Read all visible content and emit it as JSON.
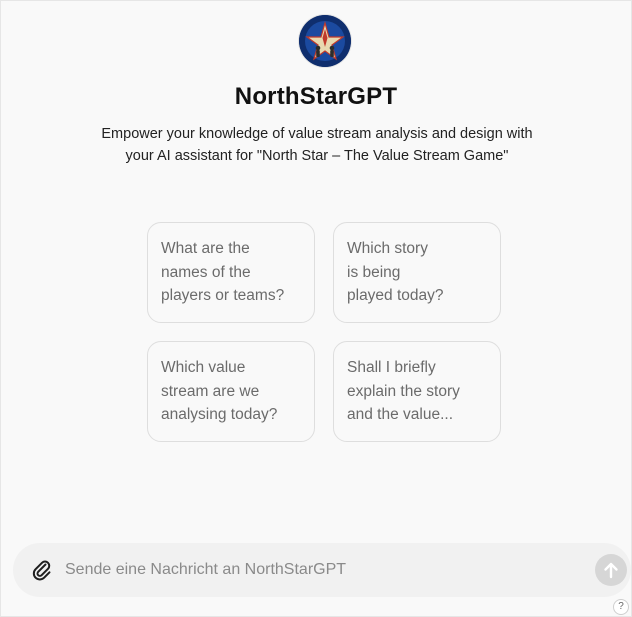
{
  "header": {
    "logo_icon": "north-star-compass-logo",
    "title": "NorthStarGPT",
    "description": "Empower your knowledge of value stream analysis and design with\nyour AI assistant for \"North Star – The Value Stream Game\""
  },
  "suggestions": [
    {
      "text": "What are the\nnames of the\nplayers or teams?"
    },
    {
      "text": "Which story\nis being\nplayed today?"
    },
    {
      "text": "Which value\nstream are we\nanalysing today?"
    },
    {
      "text": "Shall I briefly\nexplain the story\nand the value..."
    }
  ],
  "composer": {
    "attach_icon": "paperclip-icon",
    "placeholder": "Sende eine Nachricht an NorthStarGPT",
    "value": "",
    "send_icon": "arrow-up-icon"
  },
  "help": {
    "label": "?"
  },
  "colors": {
    "background": "#f9f9f9",
    "card_border": "#dedede",
    "card_text": "#6b6b6b",
    "composer_bg": "#f1f1f1",
    "send_disabled": "#d6d6d6",
    "logo_bg": "#0f2e6e"
  }
}
